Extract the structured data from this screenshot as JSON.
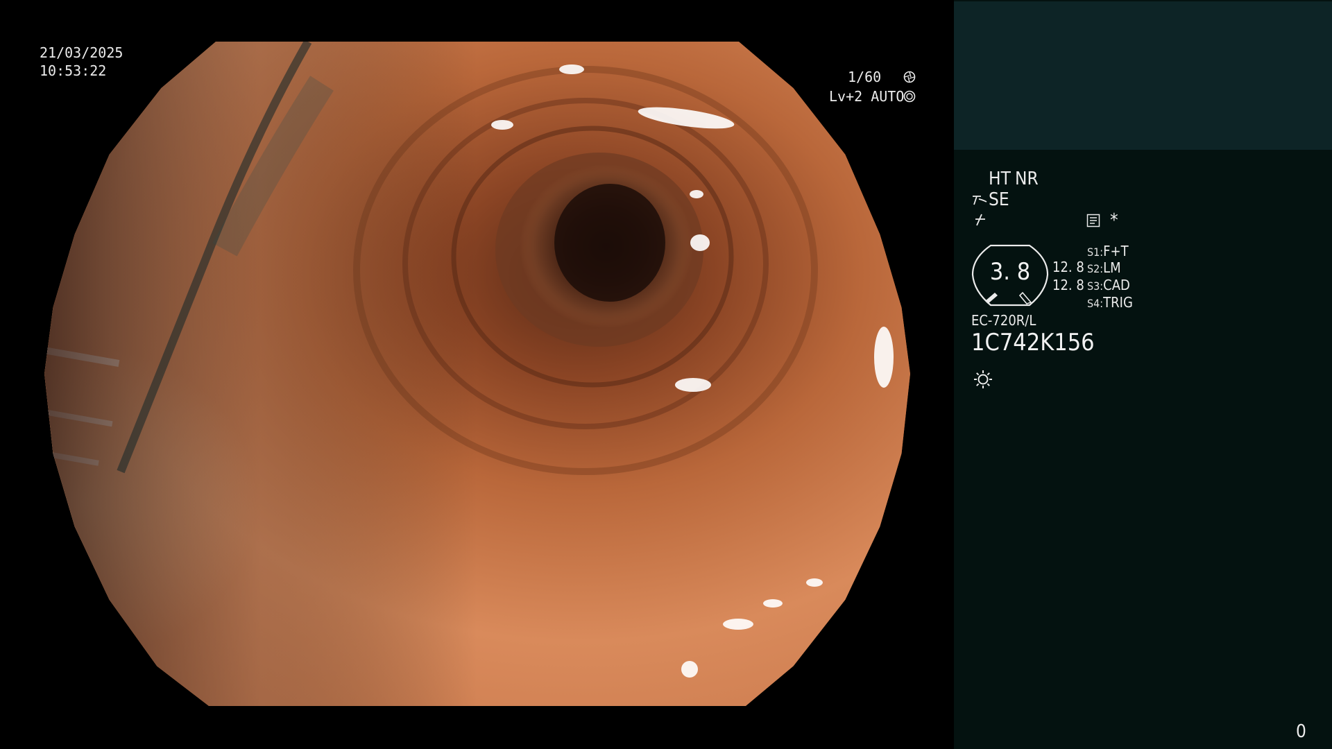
{
  "overlay": {
    "date": "21/03/2025",
    "time": "10:53:22",
    "shutter": "1/60",
    "level": "Lv+2 AUTO"
  },
  "panel": {
    "mode_ht": "HT",
    "mode_nr": "NR",
    "mode_se": "SE",
    "gauge_value": "3. 8",
    "gauge_top": "12. 8",
    "gauge_bottom": "12. 8",
    "switches": [
      {
        "key": "S1:",
        "value": "F+T"
      },
      {
        "key": "S2:",
        "value": "LM"
      },
      {
        "key": "S3:",
        "value": "CAD"
      },
      {
        "key": "S4:",
        "value": "TRIG"
      }
    ],
    "scope_model": "EC-720R/L",
    "serial": "1C742K156",
    "counter": "0"
  },
  "icons": {
    "shutter": "aperture-icon",
    "auto": "auto-exposure-icon",
    "se": "zoom-lever-icon",
    "freeze": "freeze-icon",
    "memo": "memo-icon",
    "asterisk": "asterisk-icon",
    "light": "light-icon"
  },
  "colors": {
    "panel_bg": "#041210",
    "panel_top": "#0d2426",
    "mode_active": "#f2a23a",
    "text": "#ececec"
  }
}
